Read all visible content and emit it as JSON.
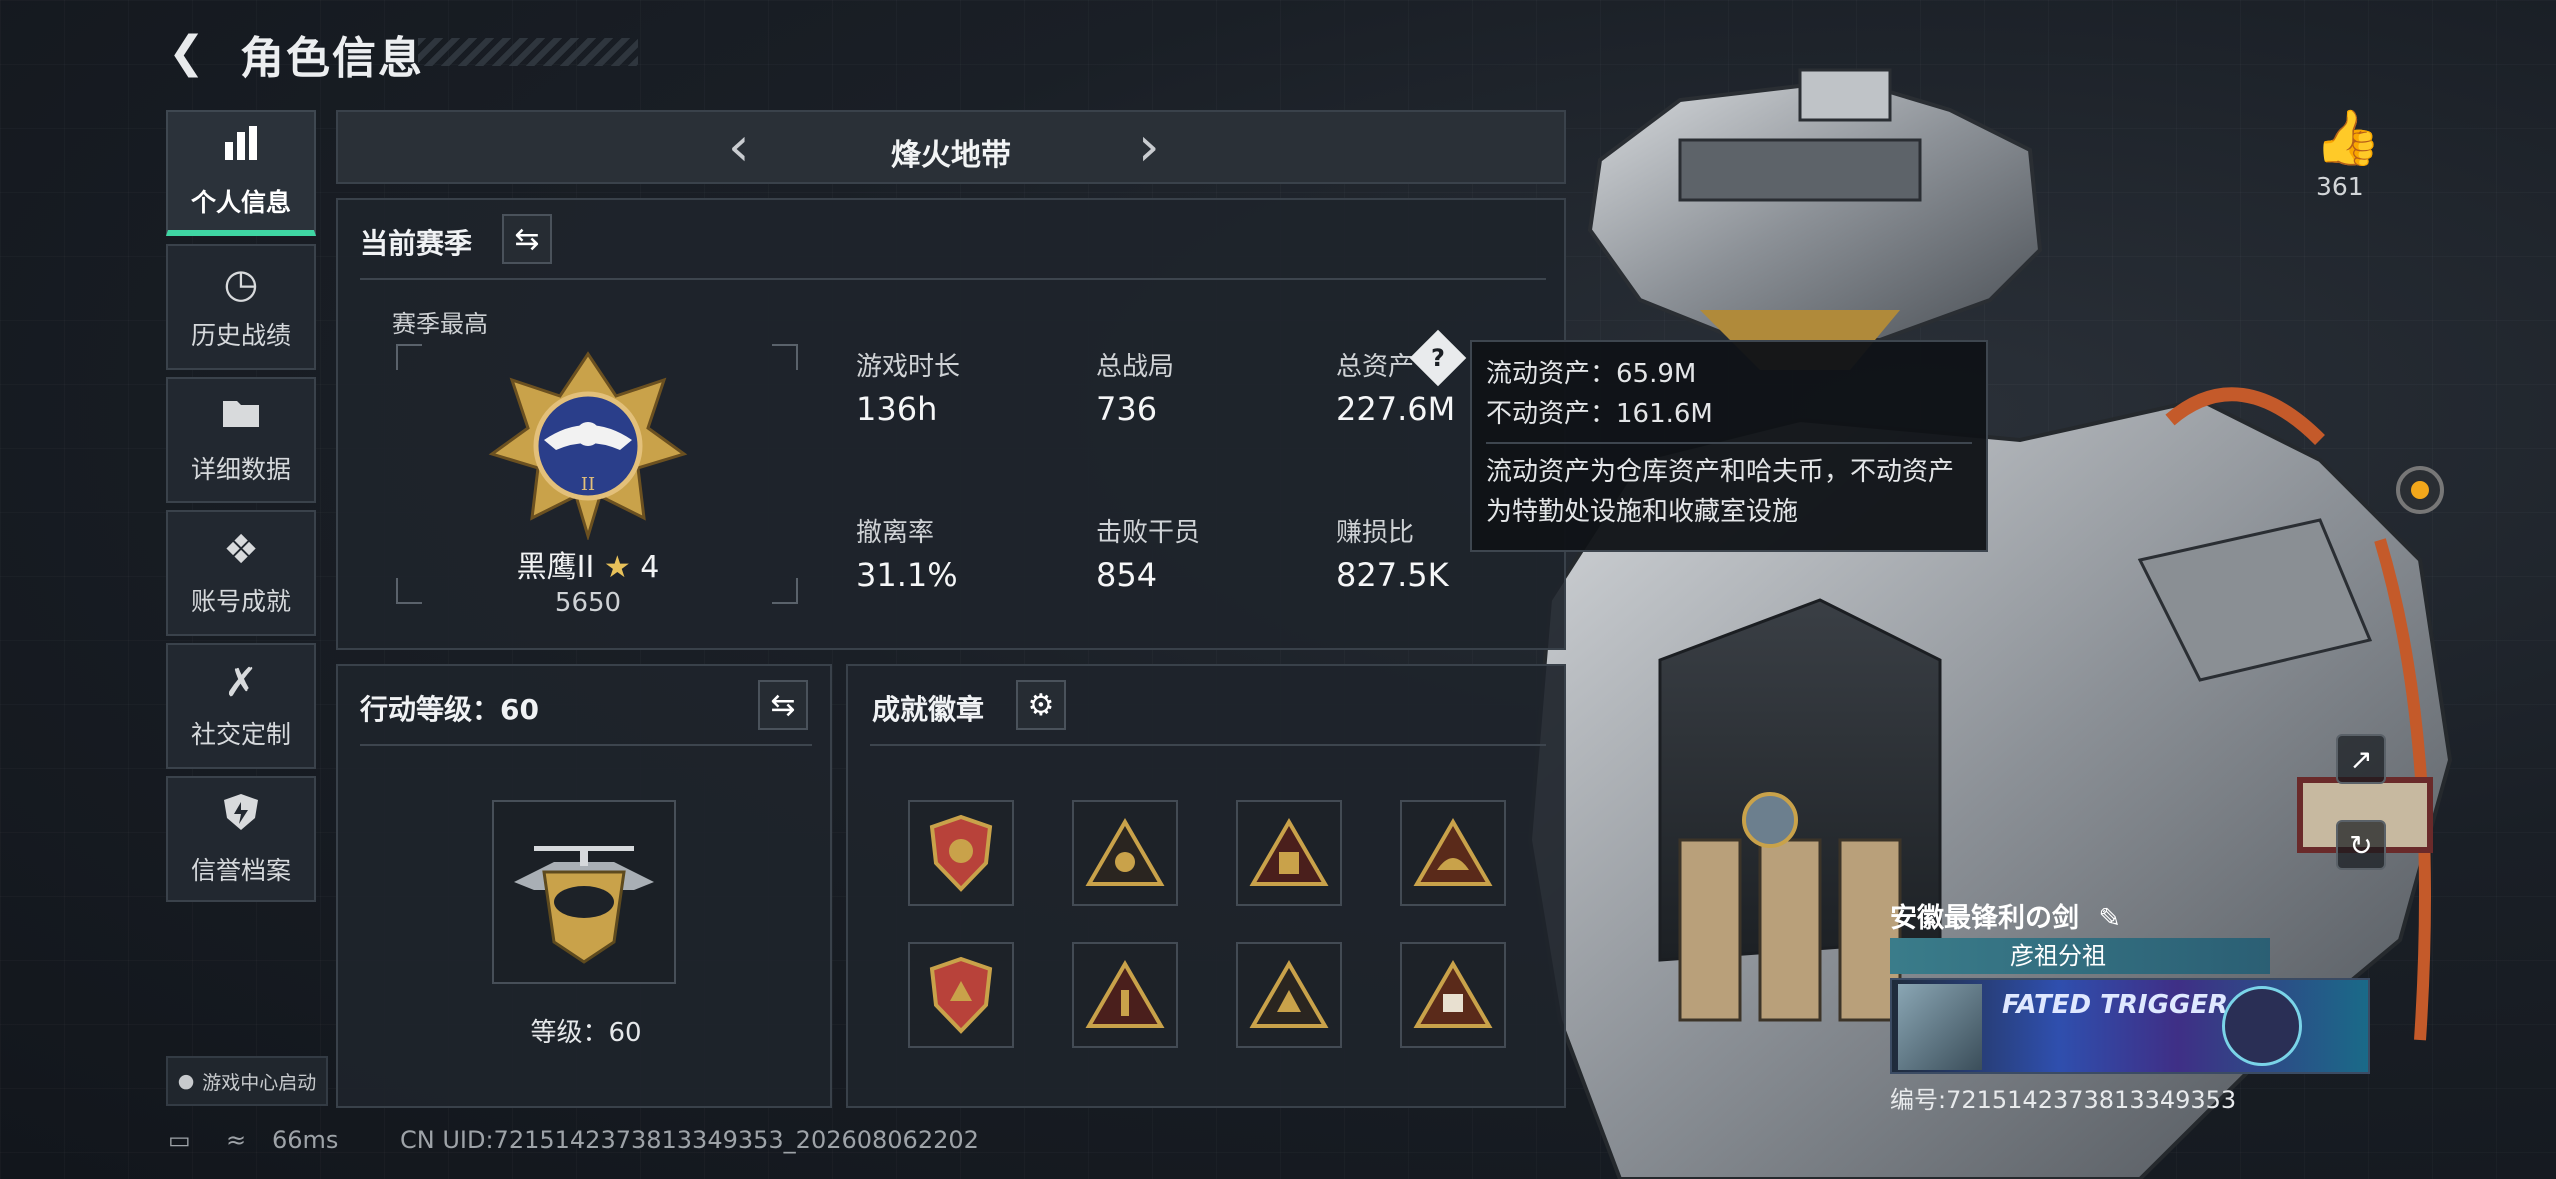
{
  "header": {
    "title": "角色信息"
  },
  "sidebar": {
    "items": [
      {
        "label": "个人信息",
        "icon": "bar-chart-icon"
      },
      {
        "label": "历史战绩",
        "icon": "clock-icon"
      },
      {
        "label": "详细数据",
        "icon": "folder-icon"
      },
      {
        "label": "账号成就",
        "icon": "medal-icon"
      },
      {
        "label": "社交定制",
        "icon": "tools-icon"
      },
      {
        "label": "信誉档案",
        "icon": "shield-icon"
      }
    ],
    "game_center": "游戏中心启动"
  },
  "mode": {
    "title": "烽火地带"
  },
  "season": {
    "title": "当前赛季",
    "best_label": "赛季最高",
    "rank_name": "黑鹰II",
    "rank_stars": "4",
    "rank_score": "5650",
    "stats": [
      {
        "label": "游戏时长",
        "value": "136h"
      },
      {
        "label": "总战局",
        "value": "736"
      },
      {
        "label": "总资产",
        "value": "227.6M"
      },
      {
        "label": "撤离率",
        "value": "31.1%"
      },
      {
        "label": "击败干员",
        "value": "854"
      },
      {
        "label": "赚损比",
        "value": "827.5K"
      }
    ]
  },
  "tooltip": {
    "liquid": "流动资产：65.9M",
    "fixed": "不动资产：161.6M",
    "desc1": "流动资产为仓库资产和哈夫币，不动资产",
    "desc2": "为特勤处设施和收藏室设施"
  },
  "action_level": {
    "title": "行动等级：60",
    "level_text": "等级：60"
  },
  "achievements": {
    "title": "成就徽章"
  },
  "footer": {
    "ping": "66ms",
    "uid": "CN UID:7215142373813349353_202608062202"
  },
  "character": {
    "likes": "361"
  },
  "card": {
    "name": "安徽最锋利の剑",
    "team": "彦祖分祖",
    "id": "编号:7215142373813349353",
    "banner_text": "FATED TRIGGER"
  },
  "colors": {
    "accent": "#3fd6a3",
    "gold": "#c9a24a",
    "panel": "#1e242b"
  }
}
